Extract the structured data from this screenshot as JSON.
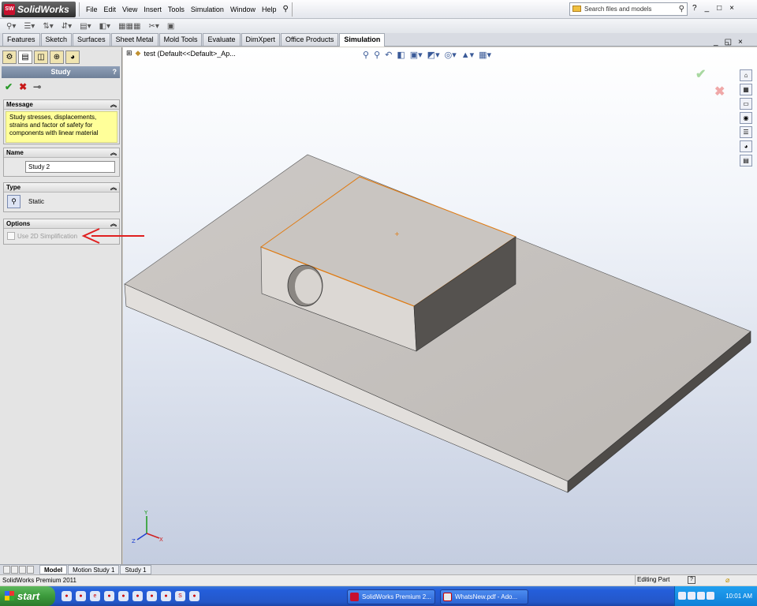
{
  "app": {
    "logo_text": "SolidWorks",
    "logo_badge": "SW"
  },
  "menu": [
    "File",
    "Edit",
    "View",
    "Insert",
    "Tools",
    "Simulation",
    "Window",
    "Help"
  ],
  "search": {
    "placeholder": "Search files and models"
  },
  "window_controls": {
    "help": "?",
    "minimize": "_",
    "restore": "□",
    "close": "×"
  },
  "command_tabs": [
    {
      "label": "Features"
    },
    {
      "label": "Sketch"
    },
    {
      "label": "Surfaces"
    },
    {
      "label": "Sheet Metal"
    },
    {
      "label": "Mold Tools"
    },
    {
      "label": "Evaluate"
    },
    {
      "label": "DimXpert"
    },
    {
      "label": "Office Products"
    },
    {
      "label": "Simulation",
      "active": true
    }
  ],
  "panel": {
    "title": "Study",
    "help": "?",
    "ok": "✔",
    "cancel": "✖",
    "pin": "⊸",
    "message": {
      "header": "Message",
      "text": "Study stresses, displacements, strains and factor of safety  for components with linear material"
    },
    "name": {
      "header": "Name",
      "value": "Study 2"
    },
    "type": {
      "header": "Type",
      "value": "Static"
    },
    "options": {
      "header": "Options",
      "checkbox_label": "Use 2D Simplification",
      "checked": false
    }
  },
  "feature_tree": {
    "label": "test  (Default<<Default>_Ap..."
  },
  "confirm": {
    "ok": "✔",
    "cancel": "✖"
  },
  "model_tabs": [
    {
      "label": "Model",
      "active": true
    },
    {
      "label": "Motion Study 1"
    },
    {
      "label": "Study 1"
    }
  ],
  "status": {
    "product": "SolidWorks Premium 2011",
    "mode": "Editing Part"
  },
  "triad": {
    "x": "X",
    "y": "Y",
    "z": "Z"
  },
  "taskbar": {
    "start": "start",
    "buttons": [
      {
        "label": "SolidWorks Premium 2..."
      },
      {
        "label": "WhatsNew.pdf - Ado..."
      }
    ],
    "clock": "10:01 AM"
  },
  "colors": {
    "annotation_arrow": "#e02020",
    "selected_edge": "#e08020",
    "message_bg": "#ffff99"
  }
}
